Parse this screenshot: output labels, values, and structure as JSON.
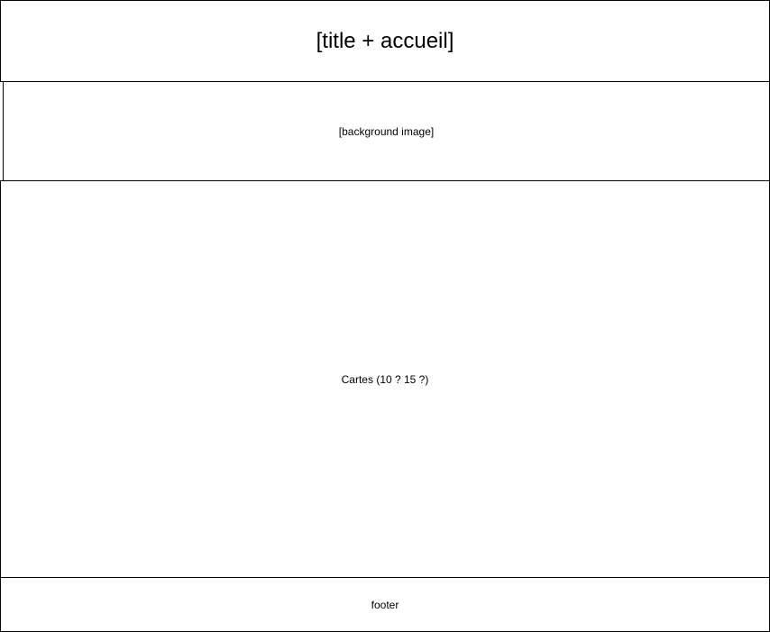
{
  "header": {
    "label": "[title + accueil]"
  },
  "banner": {
    "label": "[background image]"
  },
  "cards": {
    "label": "Cartes (10 ? 15 ?)"
  },
  "footer": {
    "label": "footer"
  }
}
